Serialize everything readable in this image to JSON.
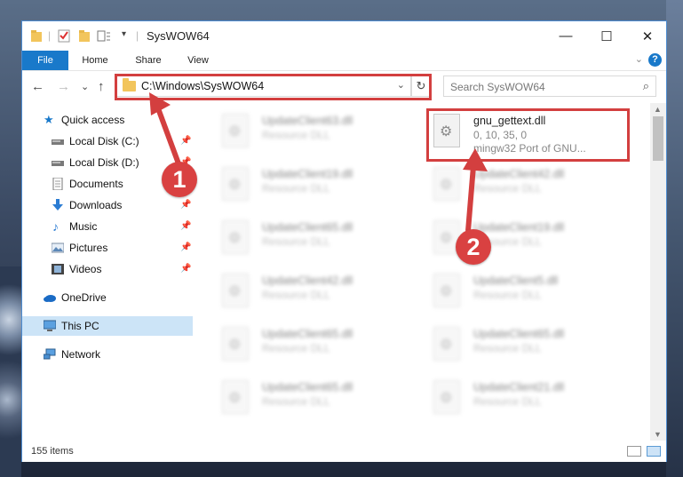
{
  "window": {
    "title": "SysWOW64",
    "controls": {
      "minimize": "—",
      "maximize": "☐",
      "close": "✕"
    }
  },
  "ribbon": {
    "tabs": [
      "File",
      "Home",
      "Share",
      "View"
    ],
    "help": "?"
  },
  "navigation": {
    "address_path": "C:\\Windows\\SysWOW64",
    "search_placeholder": "Search SysWOW64",
    "back_icon": "←",
    "forward_icon": "→",
    "recent_icon": "⌄",
    "up_icon": "↑",
    "refresh_icon": "↻",
    "search_icon": "⌕"
  },
  "sidebar": {
    "items": [
      {
        "label": "Quick access",
        "icon": "star-icon",
        "pinned": false
      },
      {
        "label": "Local Disk (C:)",
        "icon": "drive-icon",
        "pinned": true
      },
      {
        "label": "Local Disk (D:)",
        "icon": "drive-icon",
        "pinned": true
      },
      {
        "label": "Documents",
        "icon": "documents-icon",
        "pinned": true
      },
      {
        "label": "Downloads",
        "icon": "download-icon",
        "pinned": true
      },
      {
        "label": "Music",
        "icon": "music-icon",
        "pinned": true
      },
      {
        "label": "Pictures",
        "icon": "pictures-icon",
        "pinned": true
      },
      {
        "label": "Videos",
        "icon": "videos-icon",
        "pinned": true
      },
      {
        "label": "OneDrive",
        "icon": "cloud-icon",
        "pinned": false
      },
      {
        "label": "This PC",
        "icon": "computer-icon",
        "pinned": false,
        "selected": true
      },
      {
        "label": "Network",
        "icon": "network-icon",
        "pinned": false
      }
    ]
  },
  "files": {
    "highlighted": {
      "name": "gnu_gettext.dll",
      "version": "0, 10, 35, 0",
      "description": "mingw32 Port of GNU..."
    },
    "blurred": [
      {
        "name": "UpdateClient63.dll",
        "type": "Resource DLL"
      },
      {
        "name": "UpdateClient19.dll",
        "type": "Resource DLL"
      },
      {
        "name": "UpdateClient42.dll",
        "type": "Resource DLL"
      },
      {
        "name": "UpdateClient65.dll",
        "type": "Resource DLL"
      },
      {
        "name": "UpdateClient19.dll",
        "type": "Resource DLL"
      },
      {
        "name": "UpdateClient42.dll",
        "type": "Resource DLL"
      },
      {
        "name": "UpdateClient5.dll",
        "type": "Resource DLL"
      },
      {
        "name": "UpdateClient65.dll",
        "type": "Resource DLL"
      },
      {
        "name": "UpdateClient65.dll",
        "type": "Resource DLL"
      },
      {
        "name": "UpdateClient65.dll",
        "type": "Resource DLL"
      },
      {
        "name": "UpdateClient21.dll",
        "type": "Resource DLL"
      }
    ]
  },
  "status": {
    "item_count": "155 items"
  },
  "annotations": {
    "step1": "1",
    "step2": "2",
    "color": "#d33f3f"
  },
  "colors": {
    "accent": "#1979ca",
    "selection": "#cce4f7",
    "highlight": "#d33f3f"
  }
}
